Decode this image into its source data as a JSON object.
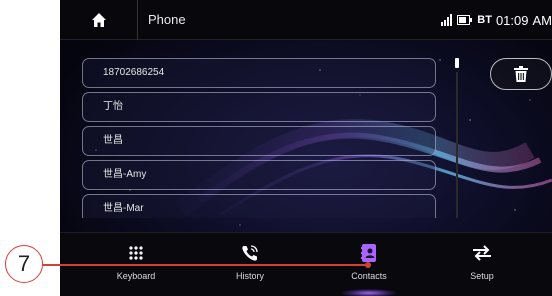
{
  "status_bar": {
    "title": "Phone",
    "bt_label": "BT",
    "time": "01:09",
    "ampm": "AM",
    "icons": [
      "home-icon",
      "signal-icon",
      "battery-icon"
    ]
  },
  "contacts": [
    {
      "label": "18702686254"
    },
    {
      "label": "丁怡"
    },
    {
      "label": "世昌"
    },
    {
      "label": "世昌-Amy"
    },
    {
      "label": "世昌-Mar"
    }
  ],
  "delete_icon": "trash-icon",
  "tabs": [
    {
      "label": "Keyboard",
      "icon": "keypad-icon"
    },
    {
      "label": "History",
      "icon": "phone-call-icon"
    },
    {
      "label": "Contacts",
      "icon": "contacts-book-icon",
      "active": true
    },
    {
      "label": "Setup",
      "icon": "swap-arrows-icon"
    }
  ],
  "callout": {
    "number": "7"
  },
  "colors": {
    "accent_active": "#a966ff",
    "callout": "#d2403a",
    "background": "#0b0b1c"
  }
}
